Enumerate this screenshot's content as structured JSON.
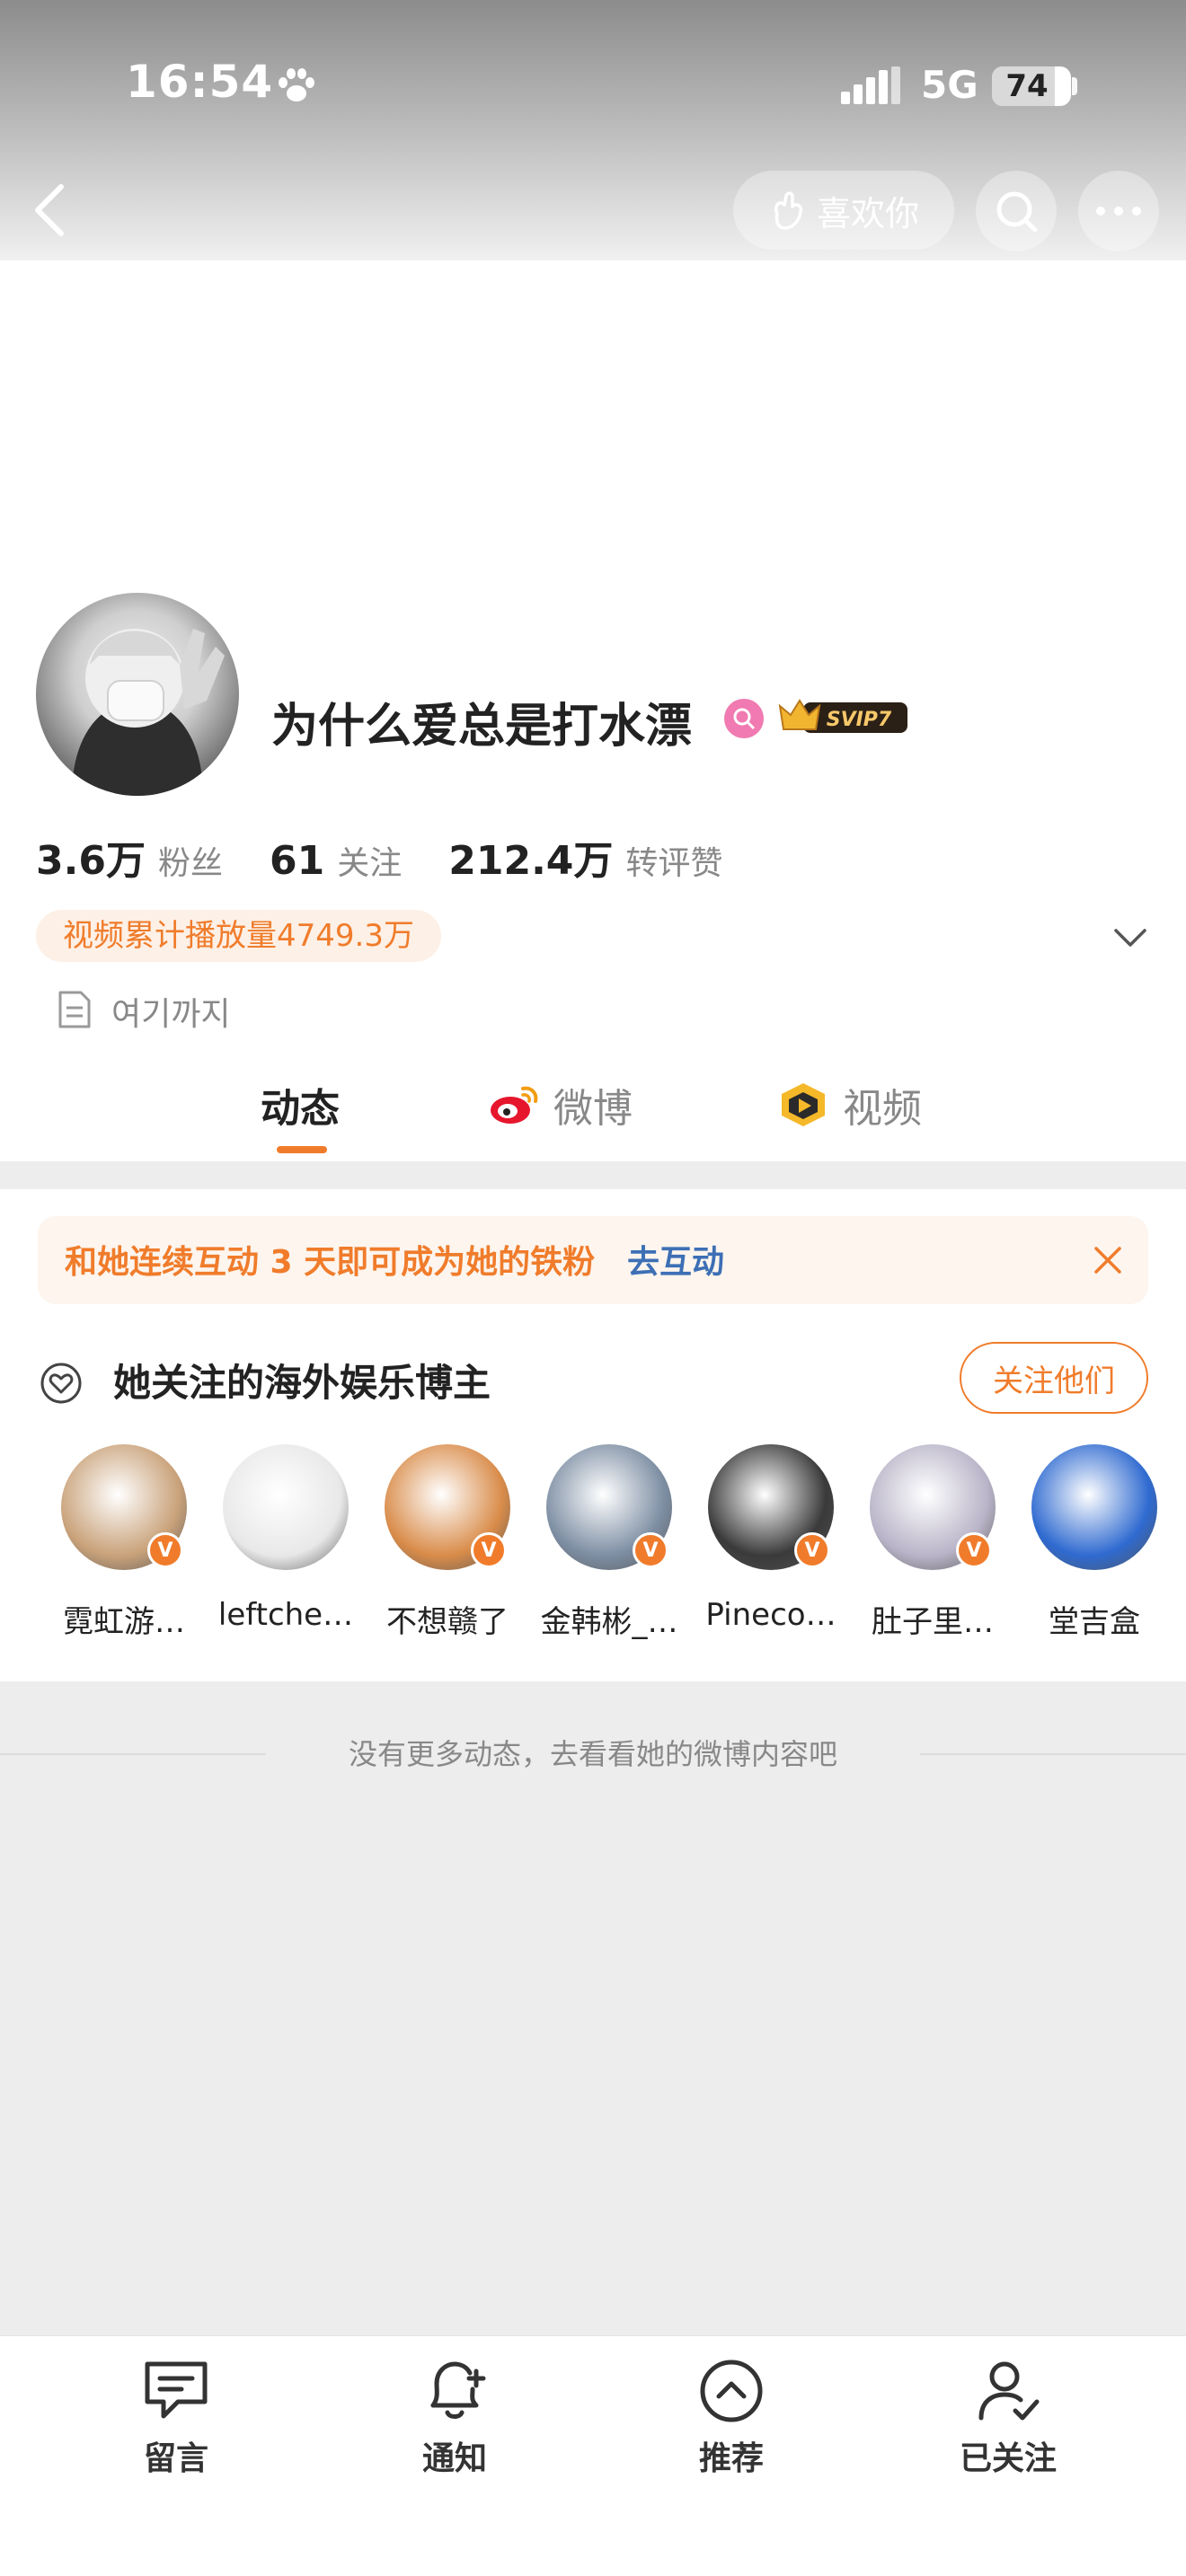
{
  "status_bar": {
    "time": "16:54",
    "network": "5G",
    "battery": "74"
  },
  "header": {
    "like_label": "喜欢你"
  },
  "profile": {
    "username": "为什么爱总是打水漂",
    "vip_badge": "SVIP7",
    "stats": [
      {
        "value": "3.6万",
        "label": "粉丝"
      },
      {
        "value": "61",
        "label": "关注"
      },
      {
        "value": "212.4万",
        "label": "转评赞"
      }
    ],
    "video_plays": "视频累计播放量4749.3万",
    "bio": "여기까지"
  },
  "tabs": [
    {
      "label": "动态",
      "active": true
    },
    {
      "label": "微博",
      "active": false
    },
    {
      "label": "视频",
      "active": false
    }
  ],
  "notice": {
    "text": "和她连续互动 3 天即可成为她的铁粉",
    "link": "去互动"
  },
  "recommend": {
    "title": "她关注的海外娱乐博主",
    "follow_button": "关注他们",
    "users": [
      {
        "name": "霓虹游…",
        "verified": true,
        "color": "#c9a27a"
      },
      {
        "name": "leftche…",
        "verified": false,
        "color": "#e8e8e8"
      },
      {
        "name": "不想赣了",
        "verified": true,
        "color": "#d98c4a"
      },
      {
        "name": "金韩彬_…",
        "verified": true,
        "color": "#7d8ea3"
      },
      {
        "name": "Pineco…",
        "verified": true,
        "color": "#3a3a3a"
      },
      {
        "name": "肚子里…",
        "verified": true,
        "color": "#b9b4c8"
      },
      {
        "name": "堂吉盒",
        "verified": false,
        "color": "#2f6ad0"
      }
    ],
    "verified_mark": "V"
  },
  "feed_end_text": "没有更多动态，去看看她的微博内容吧",
  "bottom_bar": [
    {
      "label": "留言",
      "icon": "message-icon"
    },
    {
      "label": "通知",
      "icon": "bell-plus-icon"
    },
    {
      "label": "推荐",
      "icon": "up-circle-icon"
    },
    {
      "label": "已关注",
      "icon": "user-check-icon"
    }
  ],
  "colors": {
    "accent": "#f07c2b",
    "link": "#3d6fb5",
    "pink_badge": "#f07ab1"
  }
}
